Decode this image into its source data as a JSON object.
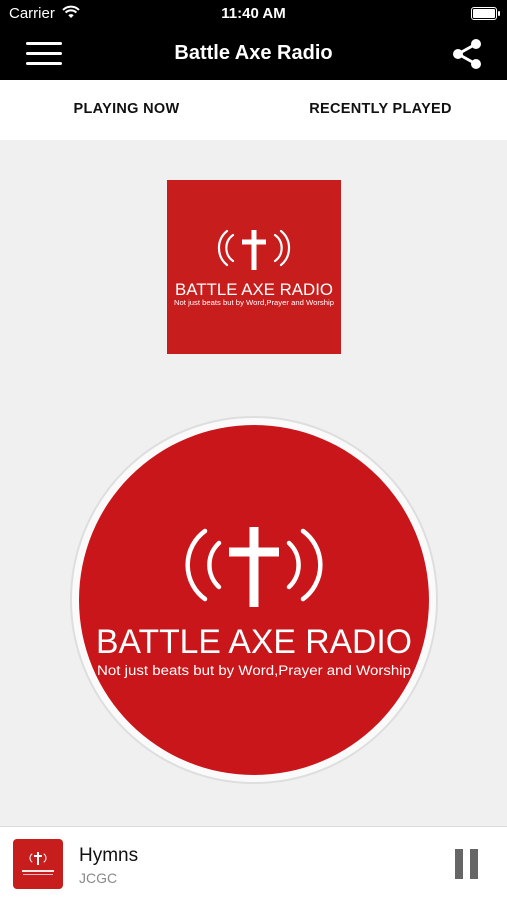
{
  "status_bar": {
    "carrier": "Carrier",
    "time": "11:40 AM"
  },
  "nav": {
    "title": "Battle Axe Radio"
  },
  "tabs": [
    {
      "label": "PLAYING NOW",
      "active": true
    },
    {
      "label": "RECENTLY PLAYED",
      "active": false
    }
  ],
  "station_logo": {
    "name": "BATTLE AXE RADIO",
    "tagline": "Not just beats but by Word,Prayer and Worship"
  },
  "player": {
    "song": "Hymns",
    "artist": "JCGC",
    "state": "playing"
  },
  "colors": {
    "brand_red": "#c8161a",
    "bar_black": "#000000"
  }
}
